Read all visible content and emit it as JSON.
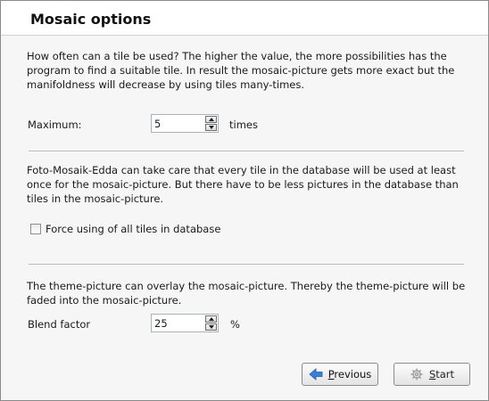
{
  "dialog": {
    "title": "Mosaic options"
  },
  "tile_usage": {
    "description": "How often can a tile be used? The higher the value, the more possibilities has the program to find a suitable tile. In result the mosaic-picture gets more exact but the manifoldness will decrease by using tiles many-times.",
    "maximum_label": "Maximum:",
    "maximum_value": "5",
    "unit": "times"
  },
  "force_tiles": {
    "description": "Foto-Mosaik-Edda can take care that every tile in the database will be used at least once for the mosaic-picture. But there have to be less pictures in the database than tiles in the mosaic-picture.",
    "checkbox_label": "Force using of all tiles in database",
    "checked": false
  },
  "blend": {
    "description": "The theme-picture can overlay the mosaic-picture. Thereby the theme-picture will be faded into the mosaic-picture.",
    "label": "Blend factor",
    "value": "25",
    "unit": "%"
  },
  "buttons": {
    "previous_label_underlined": "P",
    "previous_label_rest": "revious",
    "start_label_underlined": "S",
    "start_label_rest": "tart"
  },
  "icons": {
    "previous": "arrow-left-icon",
    "start": "gear-icon"
  },
  "colors": {
    "previous_arrow": "#3a7fd5"
  }
}
